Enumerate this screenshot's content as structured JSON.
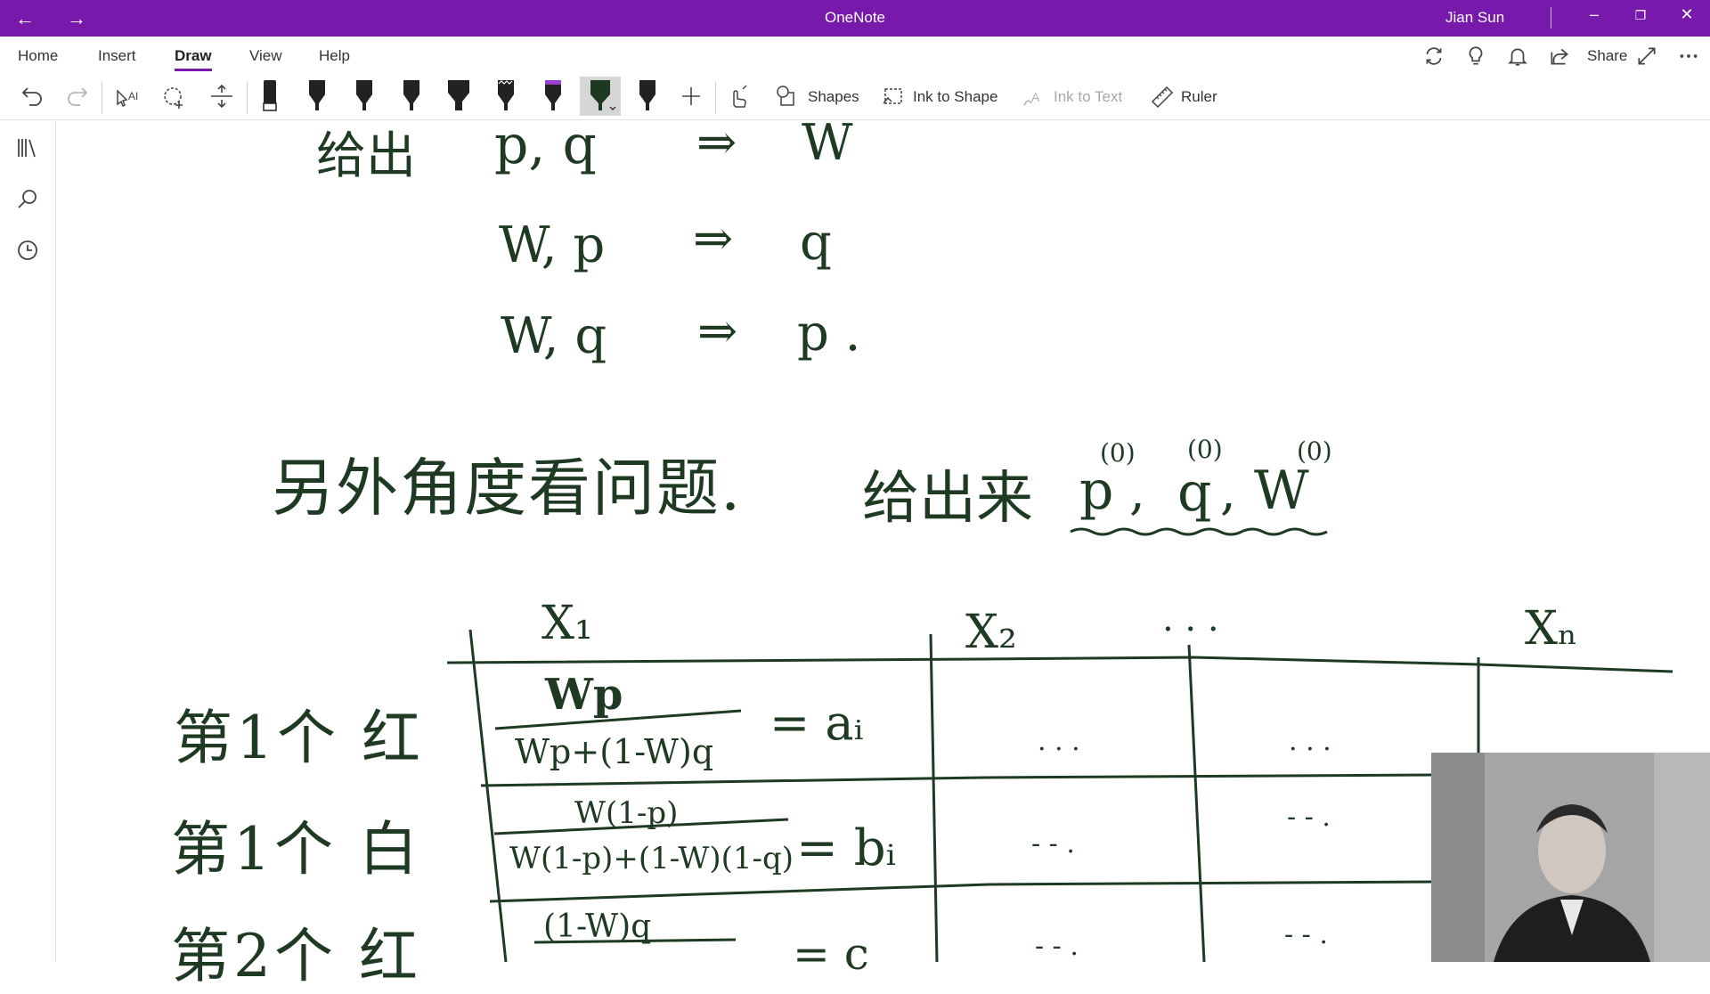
{
  "titlebar": {
    "back_icon": "arrow-left-icon",
    "forward_icon": "arrow-right-icon",
    "app_title": "OneNote",
    "user_name": "Jian Sun",
    "window_controls": [
      "minimize",
      "restore",
      "close"
    ]
  },
  "menu": {
    "tabs": [
      "Home",
      "Insert",
      "Draw",
      "View",
      "Help"
    ],
    "active_tab": "Draw",
    "share_label": "Share",
    "right_icons": [
      "sync-icon",
      "lightbulb-icon",
      "bell-icon",
      "share-icon",
      "expand-icon",
      "more-icon"
    ]
  },
  "toolbar": {
    "shapes_label": "Shapes",
    "ink_to_shape_label": "Ink to Shape",
    "ink_to_text_label": "Ink to Text",
    "ruler_label": "Ruler"
  },
  "colors": {
    "title_bar": "#7719aa",
    "ink": "#1f3a22",
    "accent": "#7719aa"
  },
  "notes": {
    "line1_given": "给出",
    "line1_lhs": "p, q",
    "line1_arrow": "⇒",
    "line1_rhs": "W",
    "line2_lhs": "W, p",
    "line2_arrow": "⇒",
    "line2_rhs": "q",
    "line3_lhs": "W, q",
    "line3_arrow": "⇒",
    "line3_rhs": "p .",
    "another_view": "另外角度看问题.",
    "give_out": "给出来",
    "p0": "p",
    "q0": "q",
    "w0": "W",
    "superscript": "(0)",
    "comma": ",",
    "col_x1": "X₁",
    "col_x2": "X₂",
    "col_dots": ". . .",
    "col_xn": "Xₙ",
    "row1_label": "第1个 红",
    "row2_label": "第1个 白",
    "row3_label": "第2个 红",
    "row1_num": "Wp",
    "row1_den": "Wp+(1-W)q",
    "row1_eq": "= aᵢ",
    "row2_num": "W(1-p)",
    "row2_den": "W(1-p)+(1-W)(1-q)",
    "row2_eq": "= bᵢ",
    "row3_num": "(1-W)q",
    "row3_eq": "= c",
    "cell_dots": ". . .",
    "cell_dashes": "- - ."
  }
}
